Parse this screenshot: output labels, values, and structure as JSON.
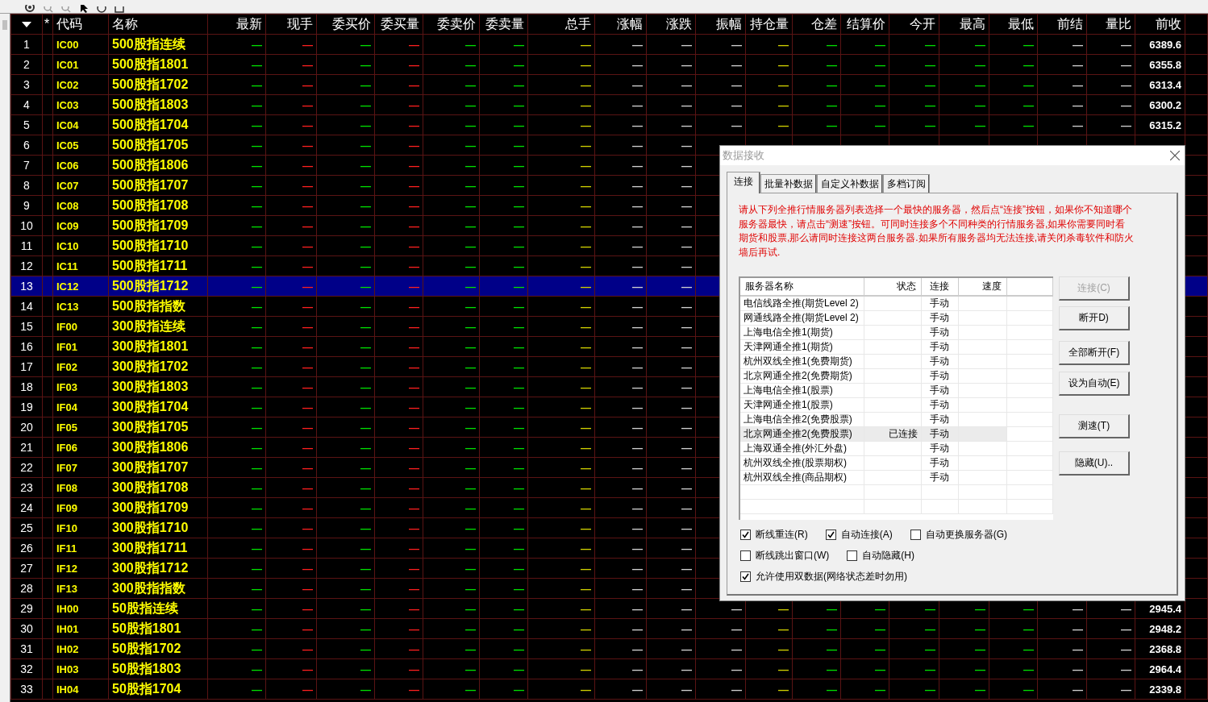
{
  "table": {
    "columns": [
      {
        "label": "*"
      },
      {
        "label": "代码"
      },
      {
        "label": "名称"
      },
      {
        "label": "最新",
        "color": "#00e000"
      },
      {
        "label": "现手",
        "color": "#ff2020"
      },
      {
        "label": "委买价",
        "color": "#00e000"
      },
      {
        "label": "委买量",
        "color": "#ff2020"
      },
      {
        "label": "委卖价",
        "color": "#00e000"
      },
      {
        "label": "委卖量",
        "color": "#00e000"
      },
      {
        "label": "总手",
        "color": "#d0d000"
      },
      {
        "label": "涨幅",
        "color": "#d0d0d0"
      },
      {
        "label": "涨跌",
        "color": "#d0d0d0"
      },
      {
        "label": "振幅",
        "color": "#d0d0d0"
      },
      {
        "label": "持仓量",
        "color": "#d0d000"
      },
      {
        "label": "仓差",
        "color": "#00e000"
      },
      {
        "label": "结算价",
        "color": "#00e000"
      },
      {
        "label": "今开",
        "color": "#00e000"
      },
      {
        "label": "最高",
        "color": "#00e000"
      },
      {
        "label": "最低",
        "color": "#00e000"
      },
      {
        "label": "前结",
        "color": "#d0d0d0"
      },
      {
        "label": "量比",
        "color": "#d0d0d0"
      },
      {
        "label": "前收",
        "color": "#ffffff"
      }
    ],
    "rows": [
      {
        "number": "1",
        "code": "IC00",
        "name": "500股指连续",
        "selected": false,
        "values": [
          "—",
          "—",
          "—",
          "—",
          "—",
          "—",
          "—",
          "—",
          "—",
          "—",
          "—",
          "—",
          "—",
          "—",
          "—",
          "—",
          "—",
          "—",
          "6389.6"
        ]
      },
      {
        "number": "2",
        "code": "IC01",
        "name": "500股指1801",
        "selected": false,
        "values": [
          "—",
          "—",
          "—",
          "—",
          "—",
          "—",
          "—",
          "—",
          "—",
          "—",
          "—",
          "—",
          "—",
          "—",
          "—",
          "—",
          "—",
          "—",
          "6355.8"
        ]
      },
      {
        "number": "3",
        "code": "IC02",
        "name": "500股指1702",
        "selected": false,
        "values": [
          "—",
          "—",
          "—",
          "—",
          "—",
          "—",
          "—",
          "—",
          "—",
          "—",
          "—",
          "—",
          "—",
          "—",
          "—",
          "—",
          "—",
          "—",
          "6313.4"
        ]
      },
      {
        "number": "4",
        "code": "IC03",
        "name": "500股指1803",
        "selected": false,
        "values": [
          "—",
          "—",
          "—",
          "—",
          "—",
          "—",
          "—",
          "—",
          "—",
          "—",
          "—",
          "—",
          "—",
          "—",
          "—",
          "—",
          "—",
          "—",
          "6300.2"
        ]
      },
      {
        "number": "5",
        "code": "IC04",
        "name": "500股指1704",
        "selected": false,
        "values": [
          "—",
          "—",
          "—",
          "—",
          "—",
          "—",
          "—",
          "—",
          "—",
          "—",
          "—",
          "—",
          "—",
          "—",
          "—",
          "—",
          "—",
          "—",
          "6315.2"
        ]
      },
      {
        "number": "6",
        "code": "IC05",
        "name": "500股指1705",
        "selected": false,
        "values": [
          "—",
          "—",
          "—",
          "—",
          "—",
          "—",
          "—",
          "—",
          "—"
        ]
      },
      {
        "number": "7",
        "code": "IC06",
        "name": "500股指1806",
        "selected": false,
        "values": [
          "—",
          "—",
          "—",
          "—",
          "—",
          "—",
          "—",
          "—",
          "—"
        ]
      },
      {
        "number": "8",
        "code": "IC07",
        "name": "500股指1707",
        "selected": false,
        "values": [
          "—",
          "—",
          "—",
          "—",
          "—",
          "—",
          "—",
          "—",
          "—"
        ]
      },
      {
        "number": "9",
        "code": "IC08",
        "name": "500股指1708",
        "selected": false,
        "values": [
          "—",
          "—",
          "—",
          "—",
          "—",
          "—",
          "—",
          "—",
          "—"
        ]
      },
      {
        "number": "10",
        "code": "IC09",
        "name": "500股指1709",
        "selected": false,
        "values": [
          "—",
          "—",
          "—",
          "—",
          "—",
          "—",
          "—",
          "—",
          "—"
        ]
      },
      {
        "number": "11",
        "code": "IC10",
        "name": "500股指1710",
        "selected": false,
        "values": [
          "—",
          "—",
          "—",
          "—",
          "—",
          "—",
          "—",
          "—",
          "—"
        ]
      },
      {
        "number": "12",
        "code": "IC11",
        "name": "500股指1711",
        "selected": false,
        "values": [
          "—",
          "—",
          "—",
          "—",
          "—",
          "—",
          "—",
          "—",
          "—"
        ]
      },
      {
        "number": "13",
        "code": "IC12",
        "name": "500股指1712",
        "selected": true,
        "values": [
          "—",
          "—",
          "—",
          "—",
          "—",
          "—",
          "—",
          "—",
          "—"
        ]
      },
      {
        "number": "14",
        "code": "IC13",
        "name": "500股指指数",
        "selected": false,
        "values": [
          "—",
          "—",
          "—",
          "—",
          "—",
          "—",
          "—",
          "—",
          "—"
        ]
      },
      {
        "number": "15",
        "code": "IF00",
        "name": "300股指连续",
        "selected": false,
        "values": [
          "—",
          "—",
          "—",
          "—",
          "—",
          "—",
          "—",
          "—",
          "—"
        ]
      },
      {
        "number": "16",
        "code": "IF01",
        "name": "300股指1801",
        "selected": false,
        "values": [
          "—",
          "—",
          "—",
          "—",
          "—",
          "—",
          "—",
          "—",
          "—"
        ]
      },
      {
        "number": "17",
        "code": "IF02",
        "name": "300股指1702",
        "selected": false,
        "values": [
          "—",
          "—",
          "—",
          "—",
          "—",
          "—",
          "—",
          "—",
          "—"
        ]
      },
      {
        "number": "18",
        "code": "IF03",
        "name": "300股指1803",
        "selected": false,
        "values": [
          "—",
          "—",
          "—",
          "—",
          "—",
          "—",
          "—",
          "—",
          "—"
        ]
      },
      {
        "number": "19",
        "code": "IF04",
        "name": "300股指1704",
        "selected": false,
        "values": [
          "—",
          "—",
          "—",
          "—",
          "—",
          "—",
          "—",
          "—",
          "—"
        ]
      },
      {
        "number": "20",
        "code": "IF05",
        "name": "300股指1705",
        "selected": false,
        "values": [
          "—",
          "—",
          "—",
          "—",
          "—",
          "—",
          "—",
          "—",
          "—"
        ]
      },
      {
        "number": "21",
        "code": "IF06",
        "name": "300股指1806",
        "selected": false,
        "values": [
          "—",
          "—",
          "—",
          "—",
          "—",
          "—",
          "—",
          "—",
          "—"
        ]
      },
      {
        "number": "22",
        "code": "IF07",
        "name": "300股指1707",
        "selected": false,
        "values": [
          "—",
          "—",
          "—",
          "—",
          "—",
          "—",
          "—",
          "—",
          "—"
        ]
      },
      {
        "number": "23",
        "code": "IF08",
        "name": "300股指1708",
        "selected": false,
        "values": [
          "—",
          "—",
          "—",
          "—",
          "—",
          "—",
          "—",
          "—",
          "—"
        ]
      },
      {
        "number": "24",
        "code": "IF09",
        "name": "300股指1709",
        "selected": false,
        "values": [
          "—",
          "—",
          "—",
          "—",
          "—",
          "—",
          "—",
          "—",
          "—"
        ]
      },
      {
        "number": "25",
        "code": "IF10",
        "name": "300股指1710",
        "selected": false,
        "values": [
          "—",
          "—",
          "—",
          "—",
          "—",
          "—",
          "—",
          "—",
          "—"
        ]
      },
      {
        "number": "26",
        "code": "IF11",
        "name": "300股指1711",
        "selected": false,
        "values": [
          "—",
          "—",
          "—",
          "—",
          "—",
          "—",
          "—",
          "—",
          "—"
        ]
      },
      {
        "number": "27",
        "code": "IF12",
        "name": "300股指1712",
        "selected": false,
        "values": [
          "—",
          "—",
          "—",
          "—",
          "—",
          "—",
          "—",
          "—",
          "—"
        ]
      },
      {
        "number": "28",
        "code": "IF13",
        "name": "300股指指数",
        "selected": false,
        "values": [
          "—",
          "—",
          "—",
          "—",
          "—",
          "—",
          "—",
          "—",
          "—"
        ]
      },
      {
        "number": "29",
        "code": "IH00",
        "name": "50股指连续",
        "selected": false,
        "values": [
          "—",
          "—",
          "—",
          "—",
          "—",
          "—",
          "—",
          "—",
          "—",
          "—",
          "—",
          "—",
          "—",
          "—",
          "—",
          "—",
          "—",
          "—",
          "2945.4"
        ]
      },
      {
        "number": "30",
        "code": "IH01",
        "name": "50股指1801",
        "selected": false,
        "values": [
          "—",
          "—",
          "—",
          "—",
          "—",
          "—",
          "—",
          "—",
          "—",
          "—",
          "—",
          "—",
          "—",
          "—",
          "—",
          "—",
          "—",
          "—",
          "2948.2"
        ]
      },
      {
        "number": "31",
        "code": "IH02",
        "name": "50股指1702",
        "selected": false,
        "values": [
          "—",
          "—",
          "—",
          "—",
          "—",
          "—",
          "—",
          "—",
          "—",
          "—",
          "—",
          "—",
          "—",
          "—",
          "—",
          "—",
          "—",
          "—",
          "2368.8"
        ]
      },
      {
        "number": "32",
        "code": "IH03",
        "name": "50股指1803",
        "selected": false,
        "values": [
          "—",
          "—",
          "—",
          "—",
          "—",
          "—",
          "—",
          "—",
          "—",
          "—",
          "—",
          "—",
          "—",
          "—",
          "—",
          "—",
          "—",
          "—",
          "2964.4"
        ]
      },
      {
        "number": "33",
        "code": "IH04",
        "name": "50股指1704",
        "selected": false,
        "values": [
          "—",
          "—",
          "—",
          "—",
          "—",
          "—",
          "—",
          "—",
          "—",
          "—",
          "—",
          "—",
          "—",
          "—",
          "—",
          "—",
          "—",
          "—",
          "2339.8"
        ]
      }
    ]
  },
  "dialog": {
    "title": "数据接收",
    "tabs": [
      {
        "label": "连接",
        "selected": true
      },
      {
        "label": "批量补数据",
        "selected": false
      },
      {
        "label": "自定义补数据",
        "selected": false
      },
      {
        "label": "多档订阅",
        "selected": false
      }
    ],
    "notice": "请从下列全推行情服务器列表选择一个最快的服务器，然后点“连接”按钮，如果你不知道哪个服务器最快，请点击“测速”按钮。可同时连接多个不同种类的行情服务器,如果你需要同时看期货和股票,那么请同时连接这两台服务器.如果所有服务器均无法连接,请关闭杀毒软件和防火墙后再试.",
    "server_columns": [
      "服务器名称",
      "状态",
      "连接",
      "速度"
    ],
    "servers": [
      {
        "name": "电信线路全推(期货Level 2)",
        "mode": "手动",
        "selected": false
      },
      {
        "name": "网通线路全推(期货Level 2)",
        "mode": "手动",
        "selected": false
      },
      {
        "name": "上海电信全推1(期货)",
        "mode": "手动",
        "selected": false
      },
      {
        "name": "天津网通全推1(期货)",
        "mode": "手动",
        "selected": false
      },
      {
        "name": "杭州双线全推1(免费期货)",
        "mode": "手动",
        "selected": false
      },
      {
        "name": "北京网通全推2(免费期货)",
        "mode": "手动",
        "selected": false
      },
      {
        "name": "上海电信全推1(股票)",
        "mode": "手动",
        "selected": false
      },
      {
        "name": "天津网通全推1(股票)",
        "mode": "手动",
        "selected": false
      },
      {
        "name": "上海电信全推2(免费股票)",
        "mode": "手动",
        "selected": false
      },
      {
        "name": "北京网通全推2(免费股票)",
        "status": "已连接",
        "mode": "手动",
        "selected": true
      },
      {
        "name": "上海双通全推(外汇外盘)",
        "mode": "手动",
        "selected": false
      },
      {
        "name": "杭州双线全推(股票期权)",
        "mode": "手动",
        "selected": false
      },
      {
        "name": "杭州双线全推(商品期权)",
        "mode": "手动",
        "selected": false
      }
    ],
    "buttons": [
      {
        "label": "连接(C)",
        "disabled": true
      },
      {
        "label": "断开D)",
        "disabled": false
      },
      {
        "label": "全部断开(F)",
        "disabled": false
      },
      {
        "label": "设为自动(E)",
        "disabled": false
      },
      {
        "label": "测速(T)",
        "disabled": false
      },
      {
        "label": "隐藏(U)..",
        "disabled": false
      }
    ],
    "option_rows": [
      {
        "options": [
          {
            "label": "断线重连(R)",
            "checked": true
          },
          {
            "label": "自动连接(A)",
            "checked": true
          },
          {
            "label": "自动更换服务器(G)",
            "checked": false
          }
        ]
      },
      {
        "options": [
          {
            "label": "断线跳出窗口(W)",
            "checked": false
          },
          {
            "label": "自动隐藏(H)",
            "checked": false
          }
        ]
      },
      {
        "options": [
          {
            "label": "允许使用双数据(网络状态差时勿用)",
            "checked": true
          }
        ]
      }
    ]
  }
}
